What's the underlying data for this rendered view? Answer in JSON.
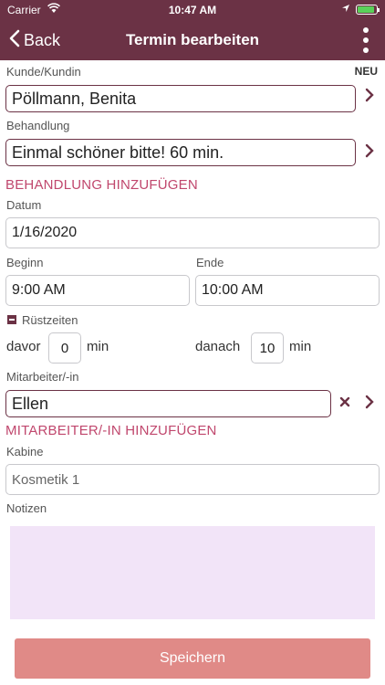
{
  "status_bar": {
    "carrier": "Carrier",
    "time": "10:47 AM"
  },
  "nav": {
    "back_label": "Back",
    "title": "Termin bearbeiten"
  },
  "customer": {
    "label": "Kunde/Kundin",
    "new_label": "NEU",
    "value": "Pöllmann, Benita"
  },
  "treatment": {
    "label": "Behandlung",
    "value": "Einmal schöner bitte! 60 min.",
    "add_label": "BEHANDLUNG HINZUFÜGEN"
  },
  "date": {
    "label": "Datum",
    "value": "1/16/2020"
  },
  "start": {
    "label": "Beginn",
    "value": "9:00 AM"
  },
  "end": {
    "label": "Ende",
    "value": "10:00 AM"
  },
  "setup": {
    "label": "Rüstzeiten",
    "before_label": "davor",
    "before_value": "0",
    "after_label": "danach",
    "after_value": "10",
    "unit": "min"
  },
  "employee": {
    "label": "Mitarbeiter/-in",
    "value": "Ellen",
    "add_label": "MITARBEITER/-IN HINZUFÜGEN"
  },
  "cabin": {
    "label": "Kabine",
    "placeholder": "Kosmetik 1"
  },
  "notes": {
    "label": "Notizen"
  },
  "save_label": "Speichern",
  "colors": {
    "primary": "#6b3245",
    "accent": "#c0476d",
    "save": "#e08a87",
    "notes_bg": "#f2e4f8"
  }
}
